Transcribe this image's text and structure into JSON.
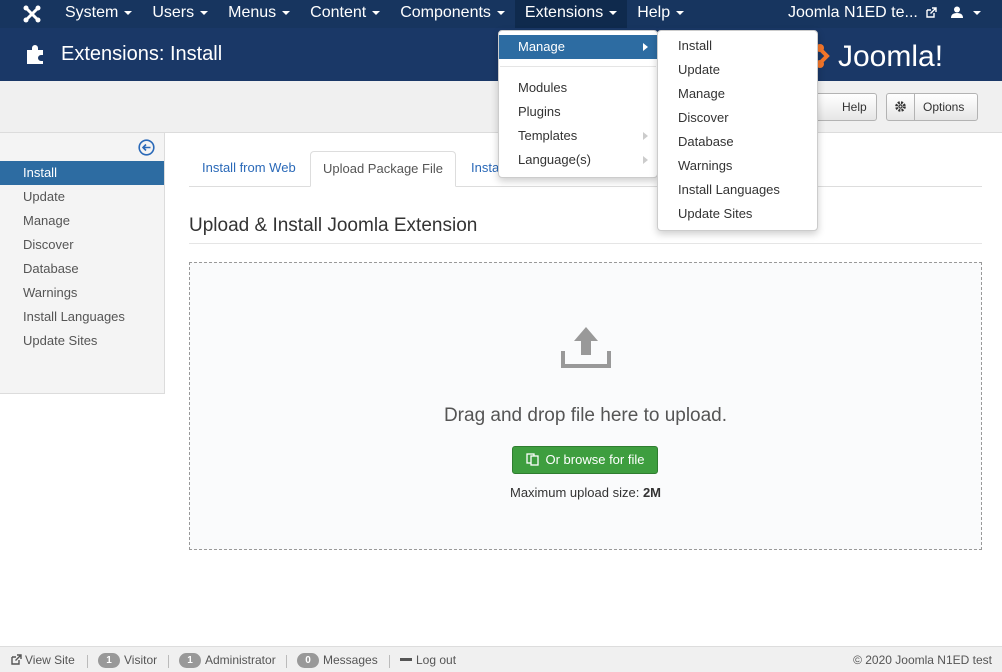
{
  "navbar": {
    "menu": [
      {
        "label": "System",
        "active": false
      },
      {
        "label": "Users",
        "active": false
      },
      {
        "label": "Menus",
        "active": false
      },
      {
        "label": "Content",
        "active": false
      },
      {
        "label": "Components",
        "active": false
      },
      {
        "label": "Extensions",
        "active": true
      },
      {
        "label": "Help",
        "active": false
      }
    ],
    "site_name": "Joomla N1ED te...",
    "icons": {
      "logo": "joomla-logo-icon",
      "external": "external-link-icon",
      "user": "user-icon"
    }
  },
  "header": {
    "title": "Extensions: Install",
    "title_icon": "puzzle-piece-icon",
    "brand": "Joomla!"
  },
  "toolbar": {
    "help_label": "Help",
    "options_label": "Options"
  },
  "sidebar": {
    "items": [
      {
        "label": "Install",
        "active": true
      },
      {
        "label": "Update",
        "active": false
      },
      {
        "label": "Manage",
        "active": false
      },
      {
        "label": "Discover",
        "active": false
      },
      {
        "label": "Database",
        "active": false
      },
      {
        "label": "Warnings",
        "active": false
      },
      {
        "label": "Install Languages",
        "active": false
      },
      {
        "label": "Update Sites",
        "active": false
      }
    ]
  },
  "tabs": [
    {
      "label": "Install from Web",
      "active": false
    },
    {
      "label": "Upload Package File",
      "active": true
    },
    {
      "label": "Insta",
      "active": false
    }
  ],
  "main": {
    "section_title": "Upload & Install Joomla Extension",
    "drop_text": "Drag and drop file here to upload.",
    "browse_label": "Or browse for file",
    "max_label": "Maximum upload size:",
    "max_value": "2M"
  },
  "extensions_menu": {
    "items": [
      {
        "label": "Manage",
        "submenu": true,
        "active": true
      },
      {
        "label": "Modules",
        "submenu": false,
        "active": false
      },
      {
        "label": "Plugins",
        "submenu": false,
        "active": false
      },
      {
        "label": "Templates",
        "submenu": true,
        "active": false
      },
      {
        "label": "Language(s)",
        "submenu": true,
        "active": false
      }
    ]
  },
  "manage_submenu": {
    "items": [
      "Install",
      "Update",
      "Manage",
      "Discover",
      "Database",
      "Warnings",
      "Install Languages",
      "Update Sites"
    ]
  },
  "statusbar": {
    "view_site": "View Site",
    "visitor_count": "1",
    "visitor_label": "Visitor",
    "admin_count": "1",
    "admin_label": "Administrator",
    "messages_count": "0",
    "messages_label": "Messages",
    "logout_label": "Log out",
    "copyright": "© 2020 Joomla N1ED test"
  },
  "colors": {
    "navbar": "#17355f",
    "header": "#1a3867",
    "accent": "#2d6ca2",
    "success": "#3e9e3f",
    "joomla_orange": "#f4762a"
  }
}
